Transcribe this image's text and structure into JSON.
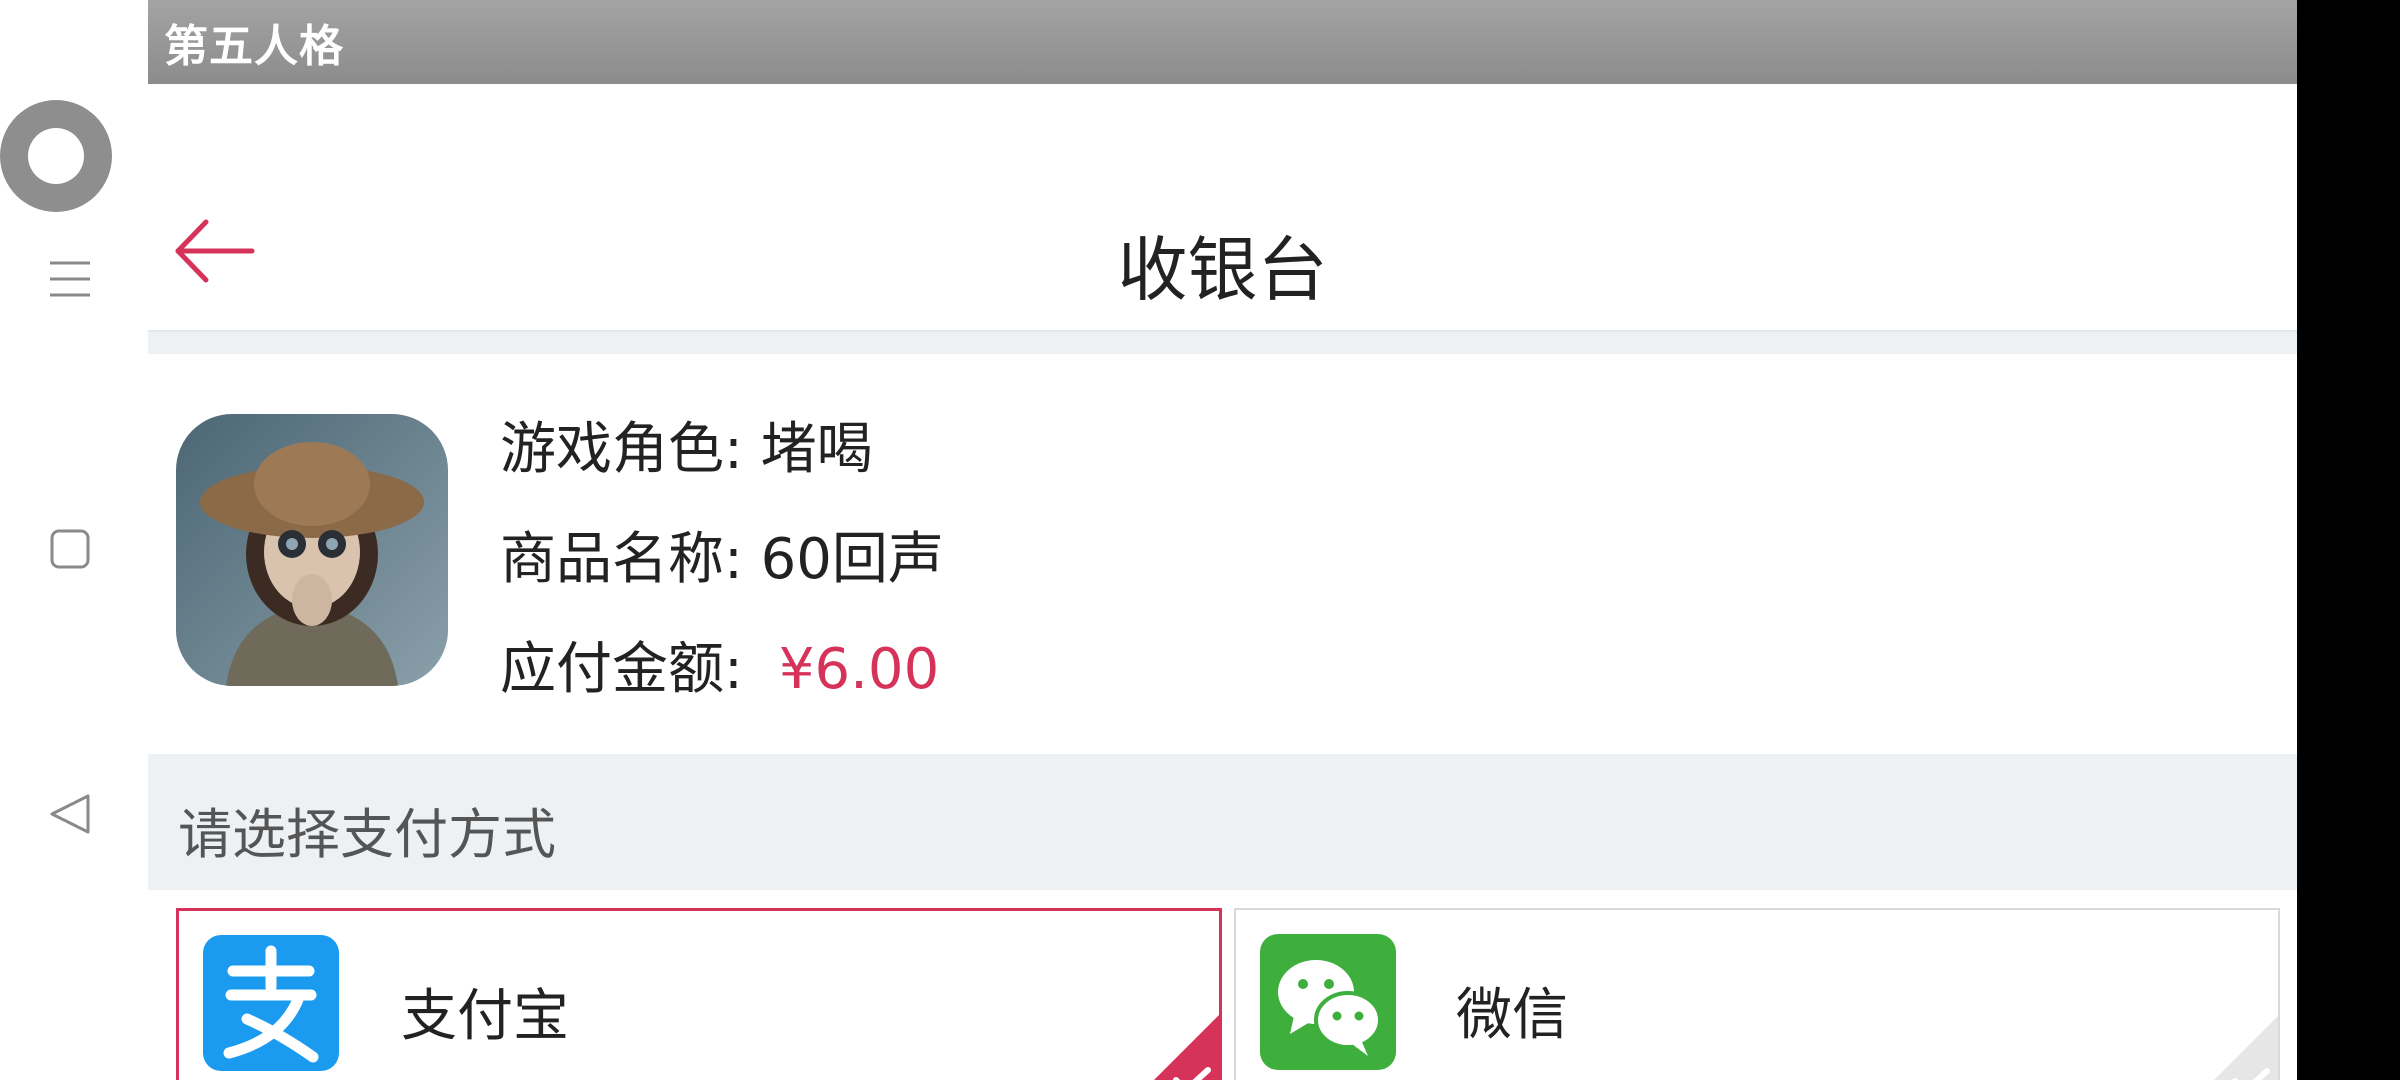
{
  "window": {
    "title": "第五人格"
  },
  "header": {
    "title": "收银台"
  },
  "order": {
    "role_label": "游戏角色: 堵喝",
    "product_label": "商品名称: 60回声",
    "amount_label": "应付金额:",
    "amount_value": "¥6.00"
  },
  "payment": {
    "section_title": "请选择支付方式",
    "options": [
      {
        "label": "支付宝",
        "selected": true
      },
      {
        "label": "微信",
        "selected": false
      }
    ]
  },
  "colors": {
    "accent": "#d6335a",
    "alipay": "#1a9bef",
    "wechat": "#3eae3c",
    "section_bg": "#eef1f4"
  },
  "icons": {
    "back": "arrow-left-icon",
    "menu": "hamburger-menu-icon",
    "square": "square-icon",
    "nav_back": "triangle-back-icon"
  }
}
